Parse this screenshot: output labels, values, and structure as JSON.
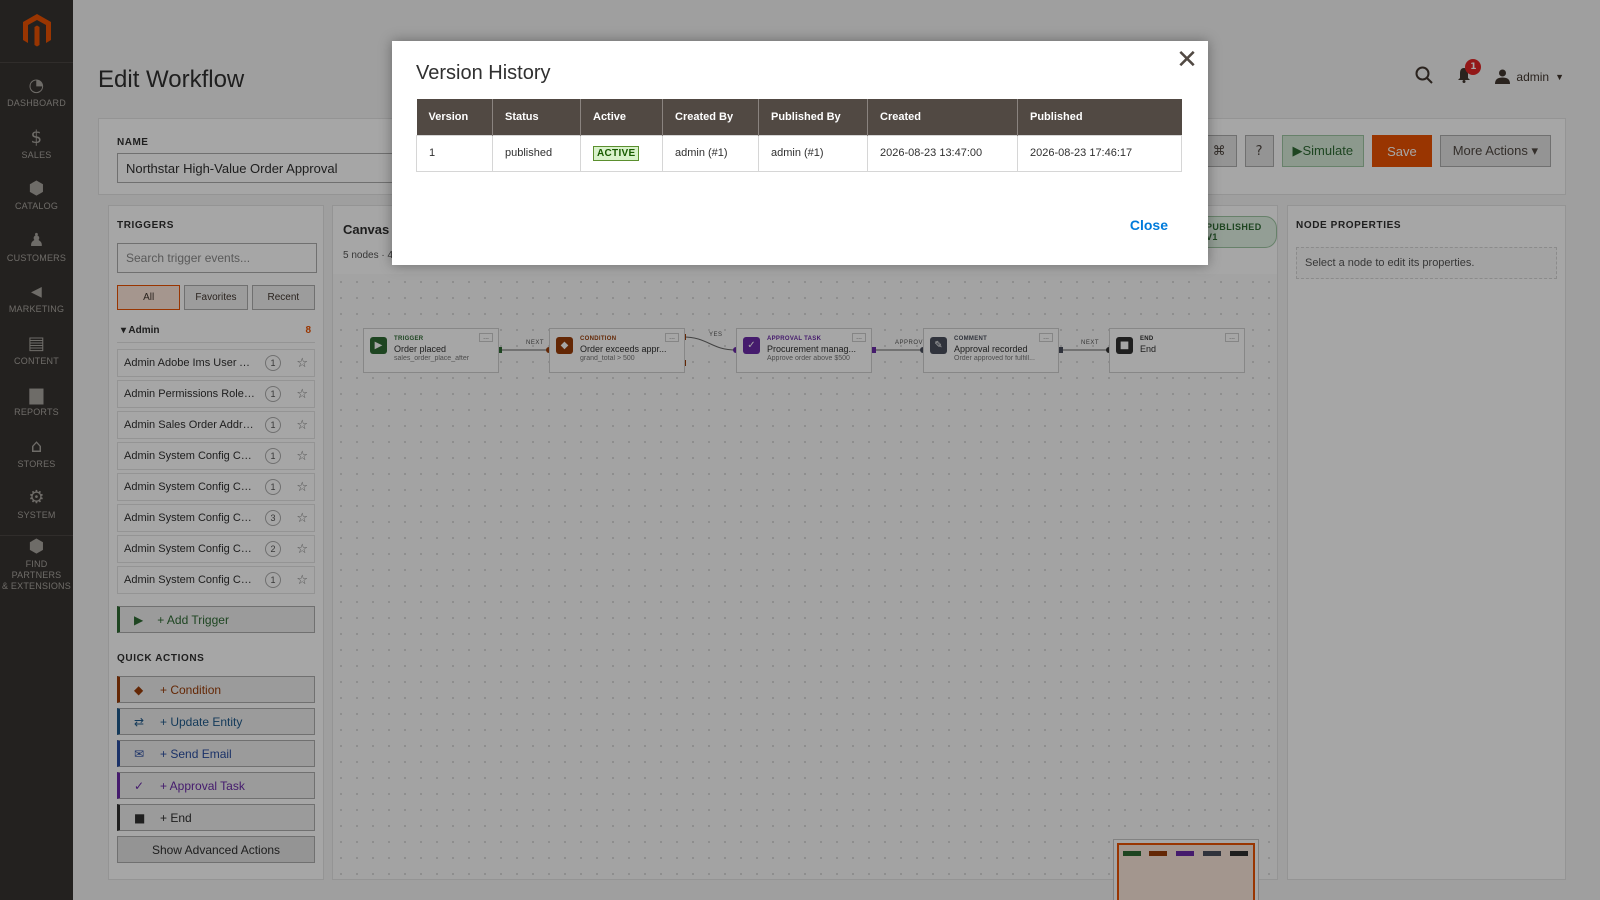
{
  "sidebar": {
    "items": [
      {
        "label": "DASHBOARD",
        "icon": "dashboard-icon",
        "glyph": "◔"
      },
      {
        "label": "SALES",
        "icon": "dollar-icon",
        "glyph": "$"
      },
      {
        "label": "CATALOG",
        "icon": "box-icon",
        "glyph": "⬢"
      },
      {
        "label": "CUSTOMERS",
        "icon": "person-icon",
        "glyph": "♟"
      },
      {
        "label": "MARKETING",
        "icon": "megaphone-icon",
        "glyph": "📢"
      },
      {
        "label": "CONTENT",
        "icon": "layout-icon",
        "glyph": "▤"
      },
      {
        "label": "REPORTS",
        "icon": "bar-chart-icon",
        "glyph": "▆"
      },
      {
        "label": "STORES",
        "icon": "store-icon",
        "glyph": "⌂"
      },
      {
        "label": "SYSTEM",
        "icon": "gear-icon",
        "glyph": "⚙"
      }
    ],
    "partners": {
      "line1": "FIND PARTNERS",
      "line2": "& EXTENSIONS"
    }
  },
  "header": {
    "title": "Edit Workflow",
    "notifications_count": "1",
    "user": "admin"
  },
  "workflow": {
    "name_label": "NAME",
    "name_value": "Northstar High-Value Order Approval"
  },
  "toolbar": {
    "shortcut_glyph": "⌘",
    "help_glyph": "?",
    "simulate_label": "▶Simulate",
    "save_label": "Save",
    "more_label": "More Actions ▾"
  },
  "triggers": {
    "title": "TRIGGERS",
    "search_placeholder": "Search trigger events...",
    "filters": [
      "All",
      "Favorites",
      "Recent"
    ],
    "group_name": "▾ Admin",
    "group_count": "8",
    "items": [
      {
        "label": "Admin Adobe Ims User Au...",
        "count": "1"
      },
      {
        "label": "Admin Permissions Role P...",
        "count": "1"
      },
      {
        "label": "Admin Sales Order Addre...",
        "count": "1"
      },
      {
        "label": "Admin System Config Cha...",
        "count": "1"
      },
      {
        "label": "Admin System Config Cha...",
        "count": "1"
      },
      {
        "label": "Admin System Config Cha...",
        "count": "3"
      },
      {
        "label": "Admin System Config Cha...",
        "count": "2"
      },
      {
        "label": "Admin System Config Cha...",
        "count": "1"
      }
    ],
    "add_label": "+ Add Trigger"
  },
  "quick_actions": {
    "title": "QUICK ACTIONS",
    "items": [
      {
        "label": "+ Condition",
        "glyph": "◆",
        "color": "#9a3d08"
      },
      {
        "label": "+ Update Entity",
        "glyph": "⇄",
        "color": "#1f5a8a"
      },
      {
        "label": "+ Send Email",
        "glyph": "✉",
        "color": "#2a4ea0"
      },
      {
        "label": "+ Approval Task",
        "glyph": "✓",
        "color": "#6a2aa8"
      },
      {
        "label": "+ End",
        "glyph": "■",
        "color": "#303030"
      }
    ],
    "show_advanced": "Show Advanced Actions"
  },
  "canvas": {
    "title": "Canvas",
    "subtitle": "5 nodes · 4",
    "status_pill": "PUBLISHED V1",
    "nodes": [
      {
        "type": "TRIGGER",
        "name": "Order placed",
        "desc": "sales_order_place_after",
        "glyph": "▶",
        "color": "#2e6b34"
      },
      {
        "type": "CONDITION",
        "name": "Order exceeds appr...",
        "desc": "grand_total > 500",
        "glyph": "◆",
        "color": "#9a3d08"
      },
      {
        "type": "APPROVAL TASK",
        "name": "Procurement manag...",
        "desc": "Approve order above $500",
        "glyph": "✓",
        "color": "#6a2aa8"
      },
      {
        "type": "COMMENT",
        "name": "Approval recorded",
        "desc": "Order approved for fulfill...",
        "glyph": "✎",
        "color": "#4a4f5c"
      },
      {
        "type": "END",
        "name": "End",
        "desc": "",
        "glyph": "■",
        "color": "#303030"
      }
    ],
    "edge_labels": [
      "NEXT",
      "YES",
      "APPROV",
      "NEXT"
    ],
    "node_menu": "..."
  },
  "node_properties": {
    "title": "NODE PROPERTIES",
    "hint": "Select a node to edit its properties."
  },
  "modal": {
    "title": "Version History",
    "columns": [
      "Version",
      "Status",
      "Active",
      "Created By",
      "Published By",
      "Created",
      "Published"
    ],
    "rows": [
      {
        "version": "1",
        "status": "published",
        "active": "ACTIVE",
        "created_by": "admin (#1)",
        "published_by": "admin (#1)",
        "created": "2026-08-23 13:47:00",
        "published": "2026-08-23 17:46:17"
      }
    ],
    "close_label": "Close"
  }
}
